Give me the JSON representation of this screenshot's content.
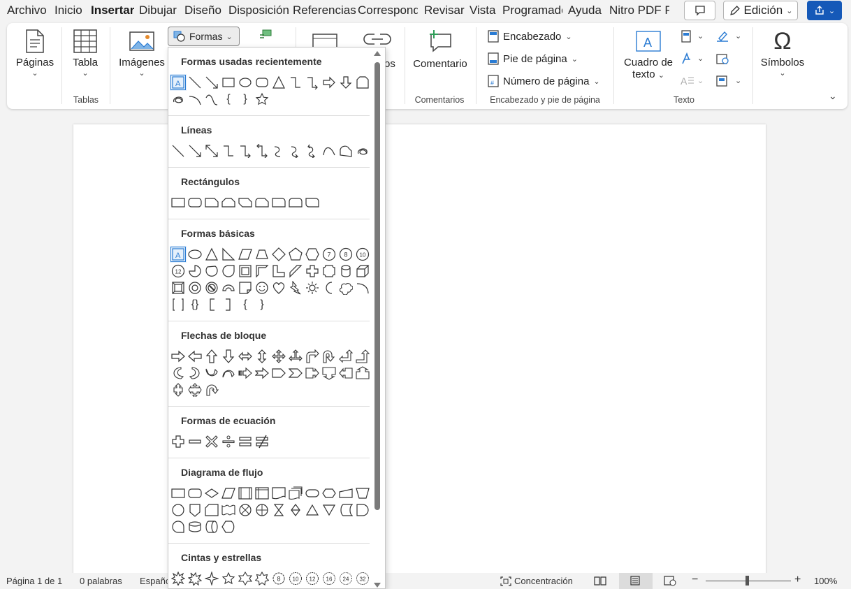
{
  "menu": {
    "tabs": [
      "Archivo",
      "Inicio",
      "Insertar",
      "Dibujar",
      "Diseño",
      "Disposición",
      "Referencias",
      "Correspondencia",
      "Revisar",
      "Vista",
      "Programador",
      "Ayuda",
      "Nitro PDF Pro"
    ],
    "active_tab": "Insertar",
    "edit_mode": "Edición"
  },
  "ribbon": {
    "pages": "Páginas",
    "table": "Tabla",
    "tables_group": "Tablas",
    "images": "Imágenes",
    "shapes": "Formas",
    "links_partial": "os",
    "comment": "Comentario",
    "comments_group": "Comentarios",
    "header": "Encabezado",
    "footer": "Pie de página",
    "page_number": "Número de página",
    "header_footer_group": "Encabezado y pie de página",
    "textbox_line1": "Cuadro de",
    "textbox_line2": "texto",
    "text_group": "Texto",
    "symbols": "Símbolos"
  },
  "shapes_menu": {
    "sections": [
      {
        "title": "Formas usadas recientemente"
      },
      {
        "title": "Líneas"
      },
      {
        "title": "Rectángulos"
      },
      {
        "title": "Formas básicas"
      },
      {
        "title": "Flechas de bloque"
      },
      {
        "title": "Formas de ecuación"
      },
      {
        "title": "Diagrama de flujo"
      },
      {
        "title": "Cintas y estrellas"
      }
    ],
    "badges": [
      "7",
      "8",
      "10",
      "12",
      "10",
      "12",
      "16",
      "24",
      "32"
    ]
  },
  "status": {
    "page": "Página 1 de 1",
    "words": "0 palabras",
    "language": "Español",
    "focus": "Concentración",
    "zoom": "100%"
  }
}
